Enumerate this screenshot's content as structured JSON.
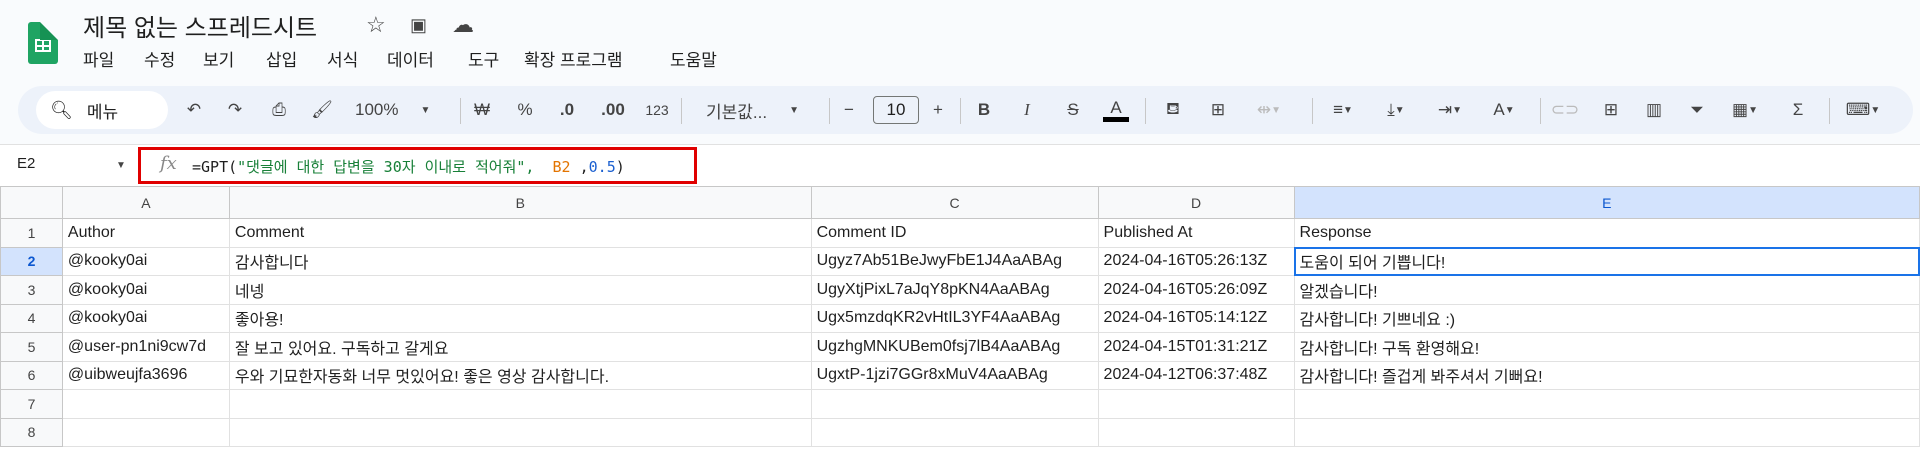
{
  "app": {
    "title": "제목 없는 스프레드시트",
    "icons": [
      "star-icon",
      "move-folder-icon",
      "cloud-saved-icon"
    ]
  },
  "menu": [
    "파일",
    "수정",
    "보기",
    "삽입",
    "서식",
    "데이터",
    "도구",
    "확장 프로그램",
    "도움말"
  ],
  "toolbar": {
    "search_label": "메뉴",
    "zoom": "100%",
    "currency": "₩",
    "percent": "%",
    "dec_decrease": ".0",
    "dec_increase": ".00",
    "number_format": "123",
    "font": "기본값...",
    "font_size": "10",
    "bold": "B",
    "italic": "I",
    "strike": "S",
    "text_color": "A",
    "sum": "Σ"
  },
  "formula_bar": {
    "cell_ref": "E2",
    "fx": "fx",
    "formula_prefix": "=GPT(",
    "formula_string": "\"댓글에 대한 답변을 30자 이내로 적어줘\",",
    "formula_ref": "  B2 ",
    "formula_num_sep": ",",
    "formula_num": "0.5",
    "formula_suffix": ")"
  },
  "colors": {
    "accent": "#1a73e8",
    "highlight": "#e00000",
    "string": "#188038",
    "ref": "#e37400",
    "number": "#1a5fd0"
  },
  "sheet": {
    "columns": [
      "A",
      "B",
      "C",
      "D",
      "E"
    ],
    "rows": [
      {
        "n": "1",
        "cells": [
          "Author",
          "Comment",
          "Comment ID",
          "Published At",
          "Response"
        ]
      },
      {
        "n": "2",
        "cells": [
          "@kooky0ai",
          "감사합니다",
          "Ugyz7Ab51BeJwyFbE1J4AaABAg",
          "2024-04-16T05:26:13Z",
          "도움이 되어 기쁩니다!"
        ]
      },
      {
        "n": "3",
        "cells": [
          "@kooky0ai",
          "네넹",
          "UgyXtjPixL7aJqY8pKN4AaABAg",
          "2024-04-16T05:26:09Z",
          "알겠습니다!"
        ]
      },
      {
        "n": "4",
        "cells": [
          "@kooky0ai",
          "좋아용!",
          "Ugx5mzdqKR2vHtIL3YF4AaABAg",
          "2024-04-16T05:14:12Z",
          "감사합니다! 기쁘네요 :)"
        ]
      },
      {
        "n": "5",
        "cells": [
          "@user-pn1ni9cw7d",
          "잘 보고 있어요. 구독하고 갈게요",
          "UgzhgMNKUBem0fsj7lB4AaABAg",
          "2024-04-15T01:31:21Z",
          "감사합니다! 구독 환영해요!"
        ]
      },
      {
        "n": "6",
        "cells": [
          "@uibweujfa3696",
          "우와 기묘한자동화 너무 멋있어요! 좋은 영상 감사합니다.",
          "UgxtP-1jzi7GGr8xMuV4AaABAg",
          "2024-04-12T06:37:48Z",
          "감사합니다! 즐겁게 봐주셔서 기뻐요!"
        ]
      },
      {
        "n": "7",
        "cells": [
          "",
          "",
          "",
          "",
          ""
        ]
      },
      {
        "n": "8",
        "cells": [
          "",
          "",
          "",
          "",
          ""
        ]
      }
    ]
  }
}
